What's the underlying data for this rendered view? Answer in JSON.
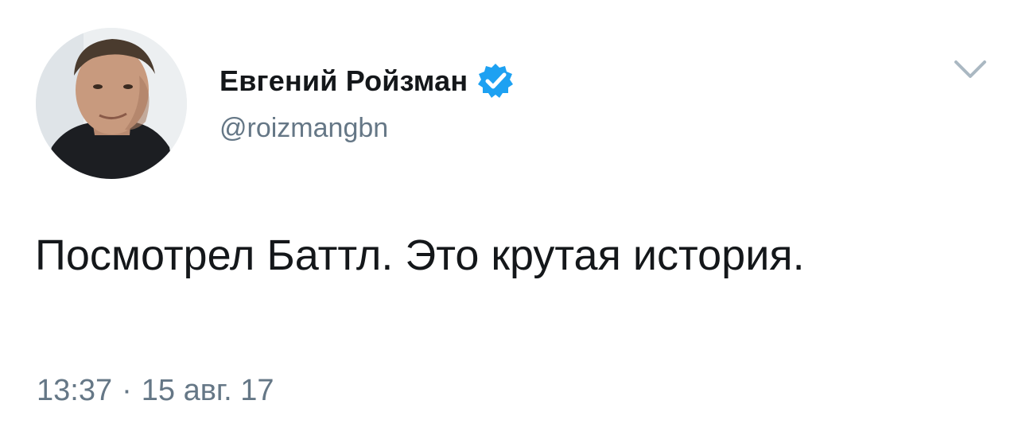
{
  "tweet": {
    "author": {
      "display_name": "Евгений Ройзман",
      "handle": "@roizmangbn",
      "verified": true,
      "avatar_icon": "user-photo"
    },
    "text": "Посмотрел Баттл. Это крутая история.",
    "time": "13:37",
    "separator": "·",
    "date": "15 авг. 17",
    "menu_icon": "chevron-down-icon"
  },
  "colors": {
    "text_primary": "#14171a",
    "text_secondary": "#657786",
    "verified_blue": "#1da1f2",
    "chevron": "#aab8c2"
  }
}
